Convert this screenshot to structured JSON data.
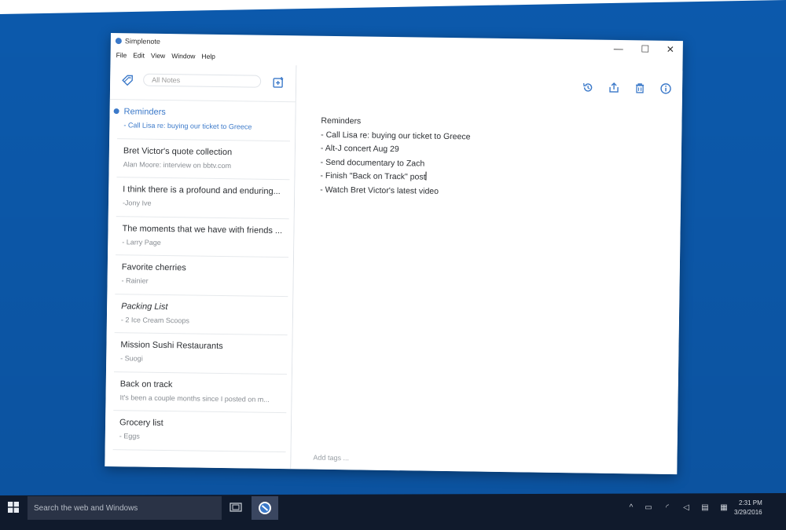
{
  "window": {
    "title": "Simplenote",
    "controls": {
      "minimize": "—",
      "maximize": "☐",
      "close": "✕"
    }
  },
  "menu": [
    "File",
    "Edit",
    "View",
    "Window",
    "Help"
  ],
  "sidebar": {
    "search_placeholder": "All Notes",
    "tags_icon": "tag-icon",
    "new_note_icon": "new-note-icon",
    "notes": [
      {
        "title": "Reminders",
        "preview": "- Call Lisa re: buying our ticket to Greece",
        "selected": true
      },
      {
        "title": "Bret Victor's quote collection",
        "preview": "Alan Moore: interview on bbtv.com"
      },
      {
        "title": "I think there is a profound and enduring...",
        "preview": "-Jony Ive"
      },
      {
        "title": "The moments that we have with friends ...",
        "preview": "- Larry Page"
      },
      {
        "title": "Favorite cherries",
        "preview": "- Rainier"
      },
      {
        "title": "Packing List",
        "preview": "- 2 Ice Cream Scoops",
        "italic": true
      },
      {
        "title": "Mission Sushi Restaurants",
        "preview": "- Suogi"
      },
      {
        "title": "Back on track",
        "preview": "It's been a couple months since I posted on m..."
      },
      {
        "title": "Grocery list",
        "preview": "- Eggs"
      }
    ]
  },
  "editor": {
    "toolbar_icons": [
      "history-icon",
      "share-icon",
      "trash-icon",
      "info-icon"
    ],
    "lines": [
      "Reminders",
      "- Call Lisa re: buying our ticket to Greece",
      "- Alt-J concert Aug 29",
      "- Send documentary to Zach",
      "- Finish \"Back on Track\" post",
      "- Watch Bret Victor's latest video"
    ],
    "tags_placeholder": "Add tags ..."
  },
  "taskbar": {
    "search_text": "Search the web and Windows",
    "time": "2:31 PM",
    "date": "3/29/2016"
  },
  "colors": {
    "accent": "#3b79c9",
    "desktop": "#0d5eb5",
    "taskbar": "#101a2c"
  }
}
